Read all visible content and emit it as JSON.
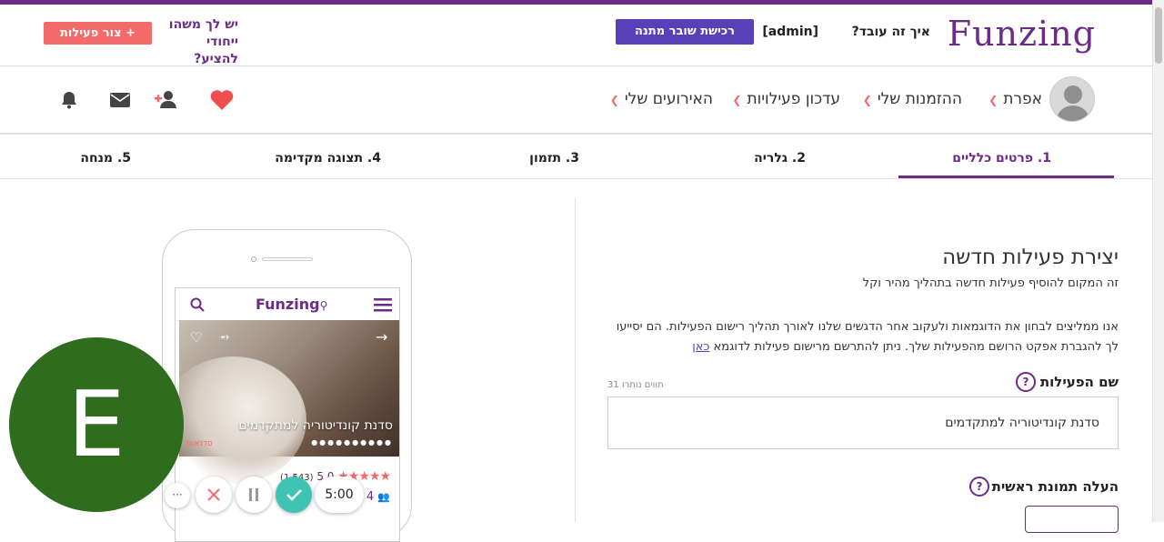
{
  "header": {
    "logo": "Funzing",
    "how_it_works": "איך זה עובד?",
    "user_tag": "[admin]",
    "gift_button": "רכישת שובר מתנה",
    "promo_line1": "יש לך משהו",
    "promo_line2": "ייחודי להציע?",
    "create_button": "+ צור פעילות"
  },
  "userbar": {
    "username": "אפרת",
    "menu": [
      {
        "label": "ההזמנות שלי"
      },
      {
        "label": "עדכון פעילויות"
      },
      {
        "label": "האירועים שלי"
      }
    ],
    "icons": [
      "heart-icon",
      "add-user-icon",
      "envelope-icon",
      "bell-icon"
    ]
  },
  "steps": [
    {
      "label": "1. פרטים כלליים",
      "active": true
    },
    {
      "label": "2. גלריה"
    },
    {
      "label": "3. תזמון"
    },
    {
      "label": "4. תצוגה מקדימה"
    },
    {
      "label": "5. מנחה"
    }
  ],
  "form": {
    "title": "יצירת פעילות חדשה",
    "subtitle": "זה המקום להוסיף פעילות חדשה בתהליך מהיר וקל",
    "intro": "אנו ממליצים לבחון את הדוגמאות ולעקוב אחר הדגשים שלנו לאורך תהליך רישום הפעילות. הם יסייעו לך להגברת אפקט הרושם מהפעילות שלך. ניתן להתרשם מרישום פעילות לדוגמא",
    "intro_link": "כאן",
    "activity_name_label": "שם הפעילות",
    "chars_left": "31 תווים נותרו",
    "activity_name_value": "סדנת קונדיטוריה למתקדמים",
    "main_image_label": "העלה תמונת ראשית",
    "help": "?"
  },
  "preview": {
    "app_logo": "Funzing",
    "title": "סדנת קונדיטוריה למתקדמים",
    "category": "סדנאות",
    "rating": "5.0",
    "reviews": "(1,543)",
    "people": "4"
  },
  "overlay": {
    "letter": "E",
    "timer": "5:00",
    "more": "···"
  },
  "colors": {
    "brand": "#6c2b85",
    "accent": "#f46a6a",
    "gift": "#5840b8",
    "overlay_circle": "#2f6d1e",
    "check": "#3fc4b4"
  }
}
